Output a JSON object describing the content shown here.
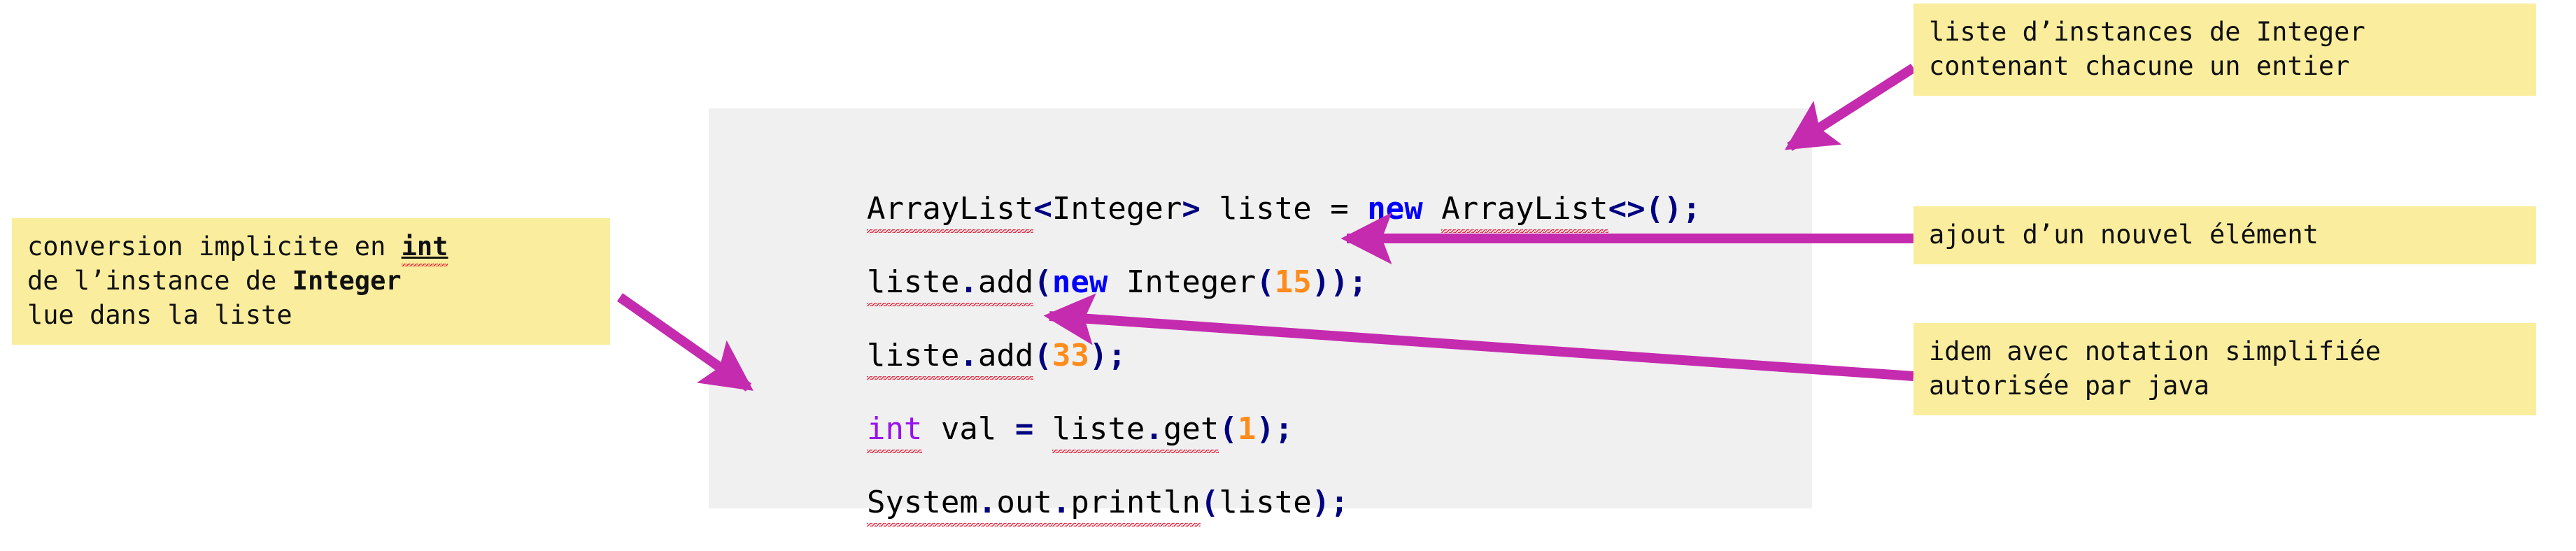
{
  "meta": {
    "kind": "annotated-java-code-slide",
    "language": "java",
    "ui_language": "fr"
  },
  "colors": {
    "page_background": "#ffffff",
    "code_background": "#f0f0f0",
    "note_background": "#faee9e",
    "arrow": "#c42bae",
    "punctuation_navy": "#000080",
    "keyword_new_blue": "#0000ff",
    "primitive_type_purple": "#9911ee",
    "number_orange": "#ff8c1a",
    "spellcheck_squiggle_red": "#e8112d",
    "code_text": "#000000",
    "note_text": "#111111"
  },
  "code": {
    "language_label": "java",
    "lines": [
      {
        "id": "line-1",
        "text": "ArrayList<Integer> liste = new ArrayList<>();",
        "tokens": [
          {
            "t": "ArrayList",
            "style": "plain",
            "squiggle": true
          },
          {
            "t": "<",
            "style": "navy"
          },
          {
            "t": "Integer",
            "style": "plain"
          },
          {
            "t": ">",
            "style": "navy"
          },
          {
            "t": " liste = ",
            "style": "plain"
          },
          {
            "t": "new",
            "style": "kw-new"
          },
          {
            "t": " ",
            "style": "plain"
          },
          {
            "t": "ArrayList",
            "style": "plain",
            "squiggle": true
          },
          {
            "t": "<>();",
            "style": "navy"
          }
        ]
      },
      {
        "id": "line-2",
        "text": "liste.add(new Integer(15));",
        "tokens": [
          {
            "t": "liste",
            "style": "plain",
            "squiggle": true
          },
          {
            "t": ".",
            "style": "navy",
            "squiggle": true
          },
          {
            "t": "add",
            "style": "plain",
            "squiggle": true
          },
          {
            "t": "(",
            "style": "navy"
          },
          {
            "t": "new",
            "style": "kw-new"
          },
          {
            "t": " Integer",
            "style": "plain"
          },
          {
            "t": "(",
            "style": "navy"
          },
          {
            "t": "15",
            "style": "num"
          },
          {
            "t": "));",
            "style": "navy"
          }
        ]
      },
      {
        "id": "line-3",
        "text": "liste.add(33);",
        "tokens": [
          {
            "t": "liste",
            "style": "plain",
            "squiggle": true
          },
          {
            "t": ".",
            "style": "navy",
            "squiggle": true
          },
          {
            "t": "add",
            "style": "plain",
            "squiggle": true
          },
          {
            "t": "(",
            "style": "navy"
          },
          {
            "t": "33",
            "style": "num"
          },
          {
            "t": ");",
            "style": "navy"
          }
        ]
      },
      {
        "id": "line-4",
        "text": "int val = liste.get(1);",
        "tokens": [
          {
            "t": "int",
            "style": "kw-int",
            "squiggle": true
          },
          {
            "t": " val ",
            "style": "plain"
          },
          {
            "t": "=",
            "style": "navy"
          },
          {
            "t": " ",
            "style": "plain"
          },
          {
            "t": "liste",
            "style": "plain",
            "squiggle": true
          },
          {
            "t": ".",
            "style": "navy",
            "squiggle": true
          },
          {
            "t": "get",
            "style": "plain",
            "squiggle": true
          },
          {
            "t": "(",
            "style": "navy"
          },
          {
            "t": "1",
            "style": "num"
          },
          {
            "t": ");",
            "style": "navy"
          }
        ]
      },
      {
        "id": "line-5",
        "text": "System.out.println(liste);",
        "tokens": [
          {
            "t": "System",
            "style": "plain",
            "squiggle": true
          },
          {
            "t": ".",
            "style": "navy",
            "squiggle": true
          },
          {
            "t": "out",
            "style": "plain",
            "squiggle": true
          },
          {
            "t": ".",
            "style": "navy",
            "squiggle": true
          },
          {
            "t": "println",
            "style": "plain",
            "squiggle": true
          },
          {
            "t": "(",
            "style": "navy"
          },
          {
            "t": "liste",
            "style": "plain"
          },
          {
            "t": ");",
            "style": "navy"
          }
        ]
      }
    ]
  },
  "notes": {
    "left": {
      "id": "note-conversion",
      "line1_a": "conversion implicite en ",
      "line1_b": "int",
      "line2_a": "de l’instance de ",
      "line2_b": "Integer",
      "line3": "lue dans la liste",
      "full_text": "conversion implicite en int de l’instance de Integer lue dans la liste"
    },
    "top_right": {
      "id": "note-liste-instances",
      "line1": "liste d’instances de Integer",
      "line2": "contenant chacune un entier",
      "full_text": "liste d’instances de Integer contenant chacune un entier"
    },
    "middle_right": {
      "id": "note-ajout",
      "line1": "ajout d’un nouvel élément",
      "full_text": "ajout d’un nouvel élément"
    },
    "bottom_right": {
      "id": "note-idem",
      "line1": "idem avec notation simplifiée",
      "line2": "autorisée par java",
      "full_text": "idem avec notation simplifiée autorisée par java"
    }
  },
  "arrows": [
    {
      "id": "arrow-to-line1",
      "from_note": "note-liste-instances",
      "to_code_line": "line-1",
      "direction": "down-left",
      "color": "#c42bae"
    },
    {
      "id": "arrow-to-line2",
      "from_note": "note-ajout",
      "to_code_line": "line-2",
      "direction": "left",
      "color": "#c42bae"
    },
    {
      "id": "arrow-to-line3",
      "from_note": "note-idem",
      "to_code_line": "line-3",
      "direction": "up-left",
      "color": "#c42bae"
    },
    {
      "id": "arrow-to-line4",
      "from_note": "note-conversion",
      "to_code_line": "line-4",
      "direction": "down-right",
      "color": "#c42bae"
    }
  ]
}
